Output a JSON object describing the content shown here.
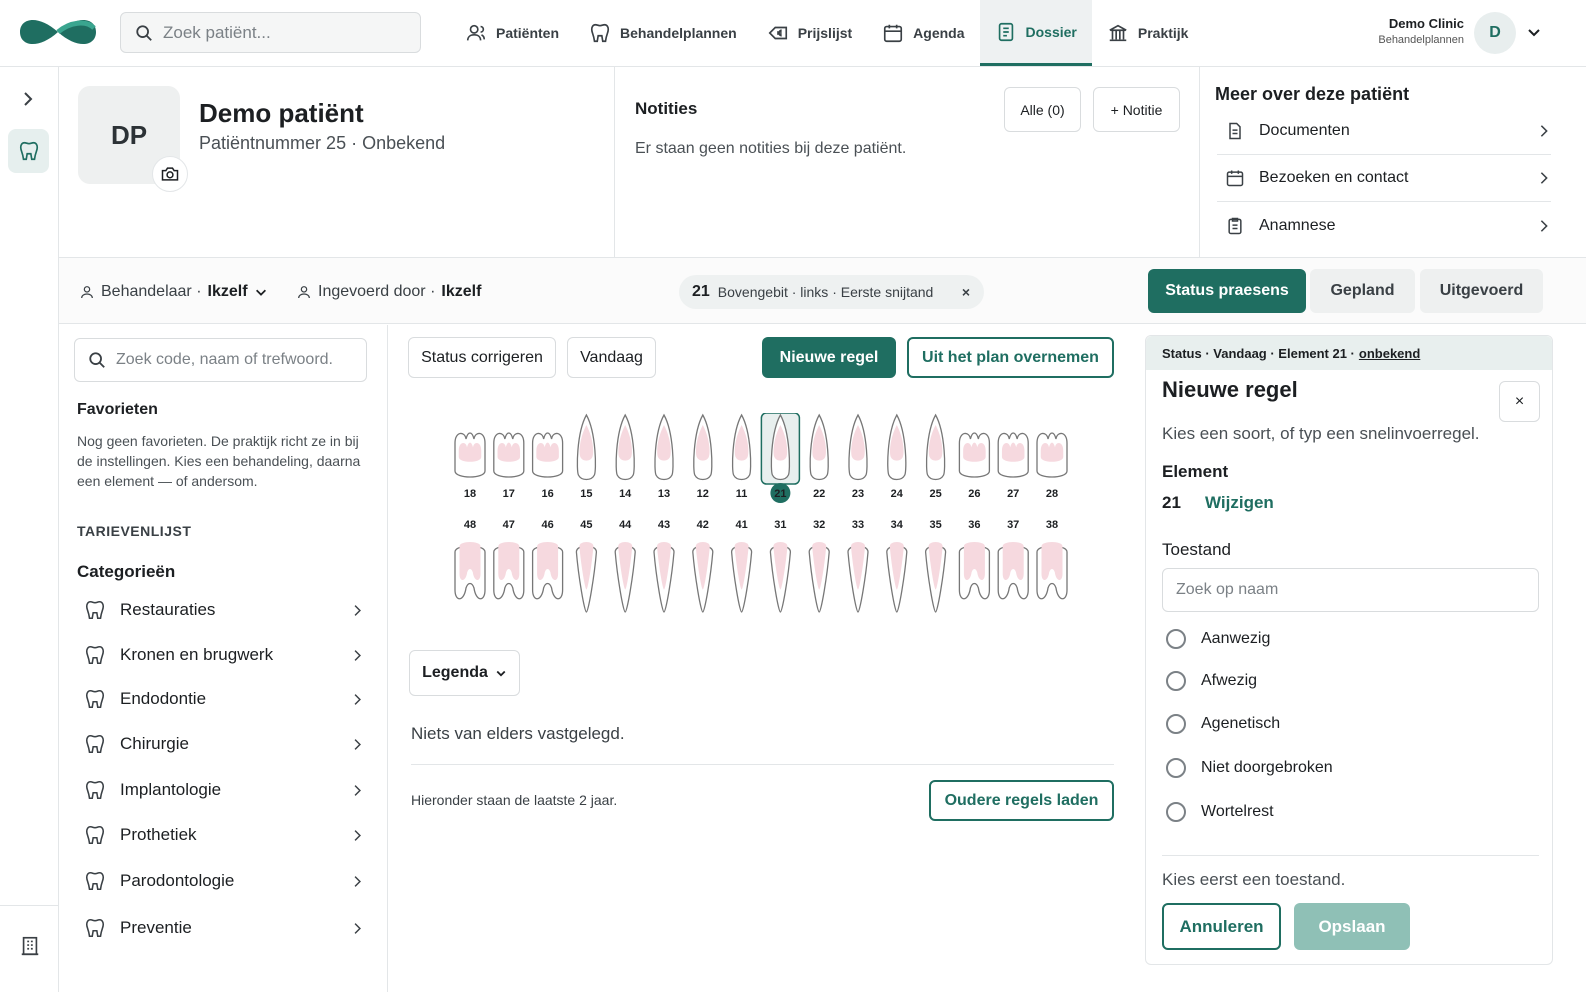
{
  "topbar": {
    "search_placeholder": "Zoek patiënt...",
    "nav": [
      {
        "label": "Patiënten",
        "icon": "user-icon"
      },
      {
        "label": "Behandelplannen",
        "icon": "tooth-icon"
      },
      {
        "label": "Prijslijst",
        "icon": "price-tag-icon"
      },
      {
        "label": "Agenda",
        "icon": "calendar-icon"
      },
      {
        "label": "Dossier",
        "icon": "file-icon",
        "active": true
      },
      {
        "label": "Praktijk",
        "icon": "building-icon"
      }
    ],
    "clinic_name": "Demo Clinic",
    "clinic_sub": "Behandelplannen",
    "avatar_initial": "D"
  },
  "patient": {
    "initials": "DP",
    "name": "Demo patiënt",
    "number": "Patiëntnummer 25",
    "status": "Onbekend",
    "sep": "·"
  },
  "notes": {
    "title": "Notities",
    "all_label": "Alle (0)",
    "new_label": "+ Notitie",
    "empty": "Er staan geen notities bij deze patiënt."
  },
  "more": {
    "title": "Meer over deze patiënt",
    "items": [
      {
        "label": "Documenten",
        "icon": "document-icon"
      },
      {
        "label": "Bezoeken en contact",
        "icon": "calendar-icon"
      },
      {
        "label": "Anamnese",
        "icon": "clipboard-icon"
      }
    ]
  },
  "filters": {
    "treater_label": "Behandelaar ·",
    "treater_value": "Ikzelf",
    "entered_label": "Ingevoerd door ·",
    "entered_value": "Ikzelf",
    "chip_num": "21",
    "chip_text": "Bovengebit · links · Eerste snijtand",
    "chip_close": "×",
    "tabs": [
      "Status praesens",
      "Gepland",
      "Uitgevoerd"
    ]
  },
  "left": {
    "search_placeholder": "Zoek code, naam of trefwoord.",
    "favorites_title": "Favorieten",
    "favorites_text": "Nog geen favorieten. De praktijk richt ze in bij de instellingen. Kies een behandeling, daarna een element — of andersom.",
    "tariff": "TARIEVENLIJST",
    "categories_title": "Categorieën",
    "categories": [
      "Restauraties",
      "Kronen en brugwerk",
      "Endodontie",
      "Chirurgie",
      "Implantologie",
      "Prothetiek",
      "Parodontologie",
      "Preventie"
    ]
  },
  "center": {
    "btn_correct": "Status corrigeren",
    "btn_today": "Vandaag",
    "btn_new": "Nieuwe regel",
    "btn_plan": "Uit het plan overnemen",
    "legend": "Legenda",
    "nothing": "Niets van elders vastgelegd.",
    "below": "Hieronder staan de laatste 2 jaar.",
    "older": "Oudere regels laden",
    "upper": [
      "18",
      "17",
      "16",
      "15",
      "14",
      "13",
      "12",
      "11",
      "21",
      "22",
      "23",
      "24",
      "25",
      "26",
      "27",
      "28"
    ],
    "lower": [
      "48",
      "47",
      "46",
      "45",
      "44",
      "43",
      "42",
      "41",
      "31",
      "32",
      "33",
      "34",
      "35",
      "36",
      "37",
      "38"
    ],
    "selected": "21"
  },
  "right": {
    "crumb_a": "Status · Vandaag · Element 21 ·",
    "crumb_b": "onbekend",
    "title": "Nieuwe regel",
    "close": "×",
    "hint": "Kies een soort, of typ een snelinvoerregel.",
    "element_label": "Element",
    "element_value": "21",
    "change": "Wijzigen",
    "condition_label": "Toestand",
    "condition_placeholder": "Zoek op naam",
    "options": [
      "Aanwezig",
      "Afwezig",
      "Agenetisch",
      "Niet doorgebroken",
      "Wortelrest"
    ],
    "footer_hint": "Kies eerst een toestand.",
    "cancel": "Annuleren",
    "save": "Opslaan"
  },
  "colors": {
    "accent": "#1f6e61",
    "accent_soft": "#e8efee"
  }
}
